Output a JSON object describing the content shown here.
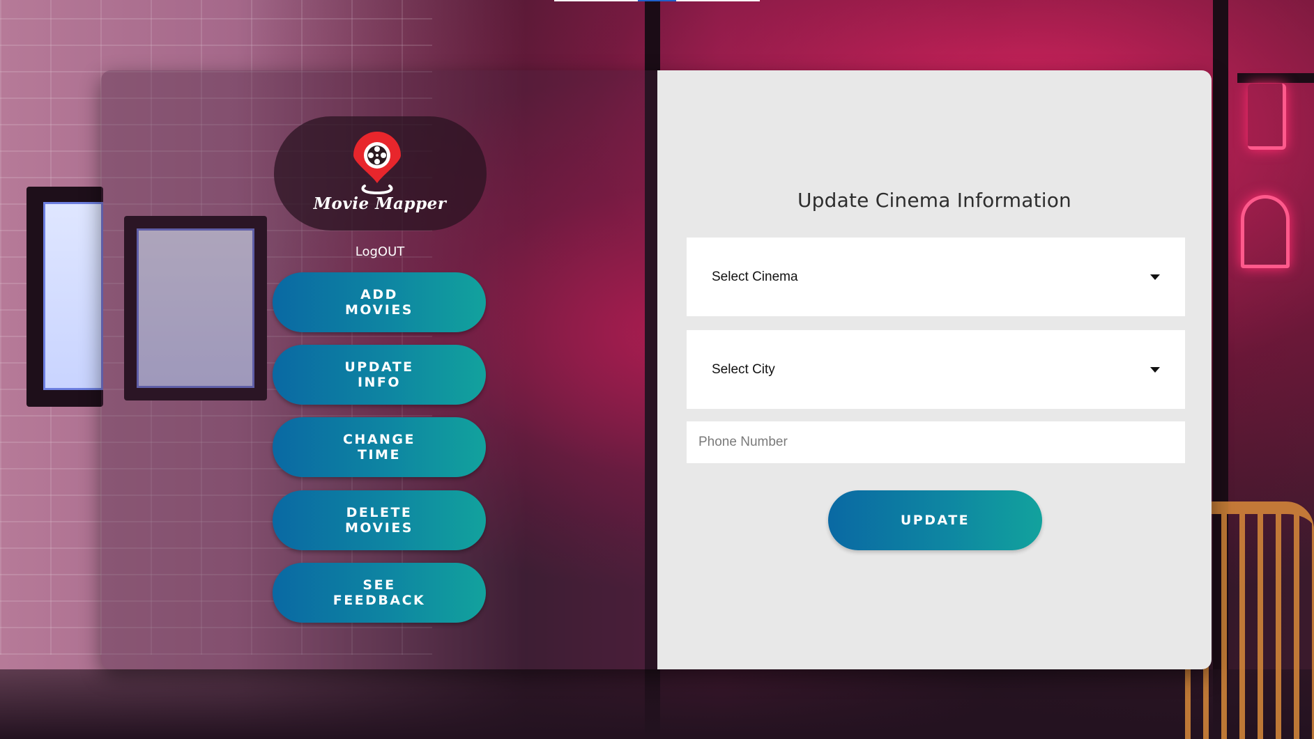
{
  "app": {
    "logo_text": "Movie Mapper",
    "logout_label": "LogOUT"
  },
  "nav": {
    "items": [
      {
        "label": "ADD MOVIES"
      },
      {
        "label": "UPDATE INFO"
      },
      {
        "label": "CHANGE TIME"
      },
      {
        "label": "DELETE MOVIES"
      },
      {
        "label": "SEE FEEDBACK"
      }
    ]
  },
  "form": {
    "title": "Update Cinema Information",
    "cinema_select": {
      "selected": "Select Cinema"
    },
    "city_select": {
      "selected": "Select City"
    },
    "phone": {
      "placeholder": "Phone Number",
      "value": ""
    },
    "submit_label": "UPDATE"
  },
  "icons": {
    "logo": "film-reel-map-pin-icon",
    "dropdown": "caret-down-icon"
  },
  "colors": {
    "button_gradient_start": "#0a69a3",
    "button_gradient_end": "#12a29d",
    "form_panel": "#e8e8e8",
    "logo_pin": "#e8262c"
  }
}
